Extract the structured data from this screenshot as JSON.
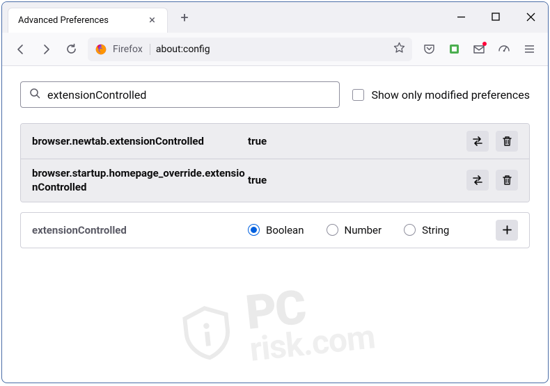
{
  "window": {
    "controls": {
      "minimize": "minimize",
      "maximize": "maximize",
      "close": "close"
    }
  },
  "tab": {
    "title": "Advanced Preferences"
  },
  "toolbar": {
    "address_label": "Firefox",
    "address_url": "about:config"
  },
  "search": {
    "value": "extensionControlled",
    "checkbox_label": "Show only modified preferences"
  },
  "prefs": [
    {
      "name": "browser.newtab.extensionControlled",
      "value": "true"
    },
    {
      "name": "browser.startup.homepage_override.extensionControlled",
      "value": "true"
    }
  ],
  "new_pref": {
    "name": "extensionControlled",
    "types": [
      "Boolean",
      "Number",
      "String"
    ],
    "selected": "Boolean"
  },
  "watermark": {
    "line1": "PC",
    "line2": "risk.com"
  }
}
